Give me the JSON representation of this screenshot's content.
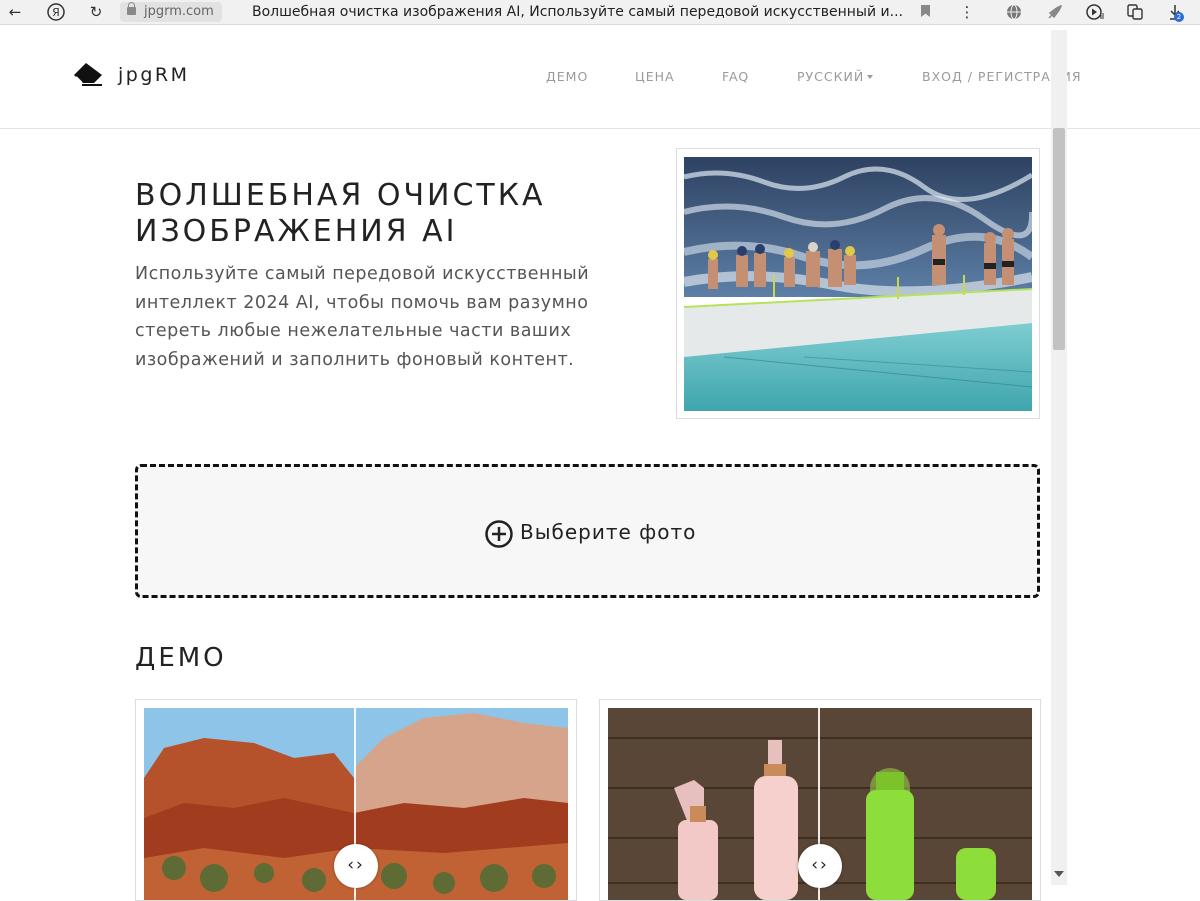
{
  "browser": {
    "domain": "jpgrm.com",
    "tab_title": "Волшебная очистка изображения AI, Используйте самый передовой искусственный и...",
    "download_count": "2"
  },
  "header": {
    "logo_text": "jpgRM",
    "nav": {
      "demo": "ДЕМО",
      "price": "ЦЕНА",
      "faq": "FAQ",
      "language": "РУССКИЙ",
      "login": "ВХОД / РЕГИСТРАЦИЯ"
    }
  },
  "hero": {
    "title": "ВОЛШЕБНАЯ ОЧИСТКА ИЗОБРАЖЕНИЯ AI",
    "description": "Используйте самый передовой искусственный интеллект 2024 AI, чтобы помочь вам разумно стереть любые нежелательные части ваших изображений и заполнить фоновый контент."
  },
  "upload": {
    "label": "Выберите фото"
  },
  "demo": {
    "heading": "ДЕМО"
  },
  "icons": {
    "back": "back-arrow-icon",
    "yandex": "yandex-icon",
    "reload": "reload-icon",
    "lock": "lock-icon",
    "bookmark": "bookmark-icon",
    "menu": "more-vertical-icon",
    "compare_handle": "compare-slider-icon",
    "upload": "plus-circle-icon"
  }
}
